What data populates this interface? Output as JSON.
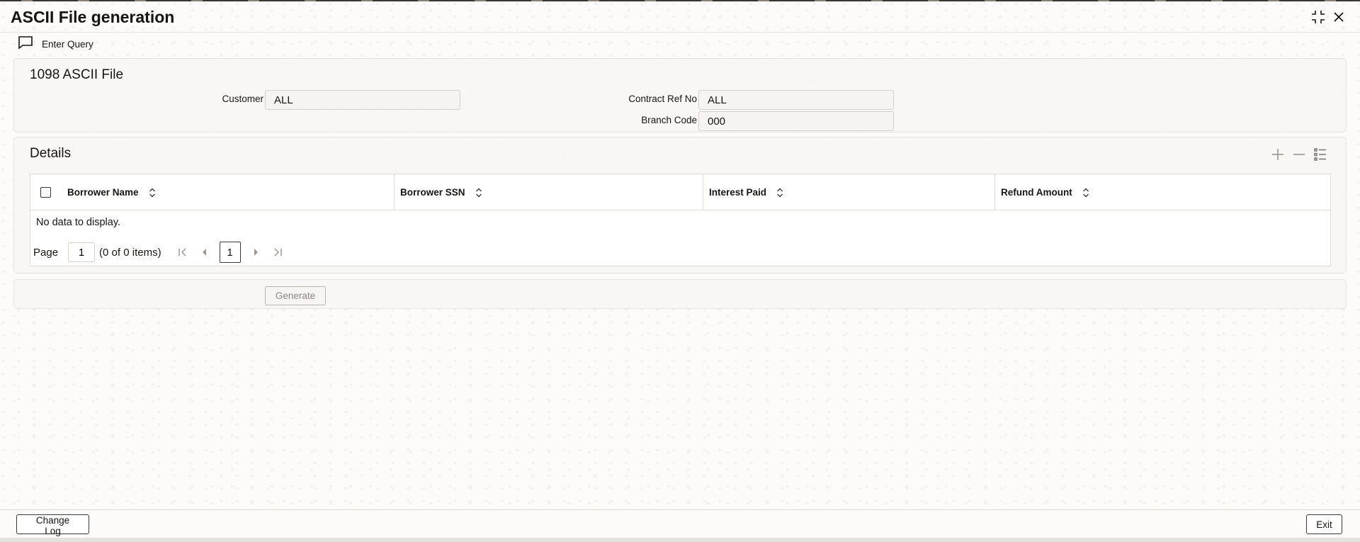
{
  "window": {
    "title": "ASCII File generation"
  },
  "toolbar": {
    "enter_query_label": "Enter Query"
  },
  "filter_panel": {
    "title": "1098 ASCII File",
    "customer_label": "Customer",
    "customer_value": "ALL",
    "contract_ref_label": "Contract Ref No",
    "contract_ref_value": "ALL",
    "branch_code_label": "Branch Code",
    "branch_code_value": "000"
  },
  "details": {
    "title": "Details",
    "columns": [
      "Borrower Name",
      "Borrower SSN",
      "Interest Paid",
      "Refund Amount"
    ],
    "empty_text": "No data to display.",
    "pager": {
      "page_label": "Page",
      "page_value": "1",
      "items_info": "(0 of 0 items)",
      "current_page": "1"
    }
  },
  "actions": {
    "generate_label": "Generate"
  },
  "footer": {
    "change_log_label": "Change Log",
    "exit_label": "Exit"
  },
  "icons": {
    "maximize": "maximize-icon",
    "close": "close-icon",
    "enter_query": "chat-bubble-icon",
    "add_row": "plus-icon",
    "delete_row": "minus-icon",
    "columns": "list-icon",
    "sort": "sort-icon",
    "first": "first-page-icon",
    "prev": "prev-page-icon",
    "next": "next-page-icon",
    "last": "last-page-icon"
  }
}
